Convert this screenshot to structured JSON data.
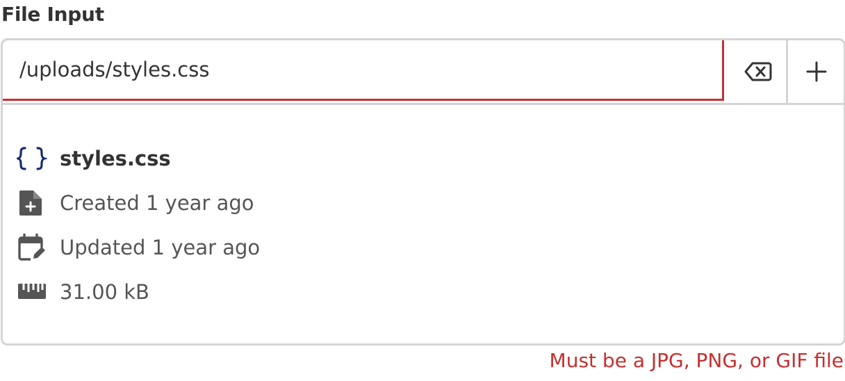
{
  "field": {
    "label": "File Input",
    "value": "/uploads/styles.css"
  },
  "buttons": {
    "clear_icon": "backspace-icon",
    "add_icon": "plus-icon"
  },
  "file": {
    "name": "styles.css",
    "type_icon": "code-braces-icon",
    "created": "Created 1 year ago",
    "updated": "Updated 1 year ago",
    "size": "31.00 kB"
  },
  "error": "Must be a JPG, PNG, or GIF file",
  "colors": {
    "error": "#c62f2f",
    "border": "#d4d4d4",
    "file_icon": "#1a2a6c",
    "text": "#333333",
    "muted": "#555555"
  }
}
